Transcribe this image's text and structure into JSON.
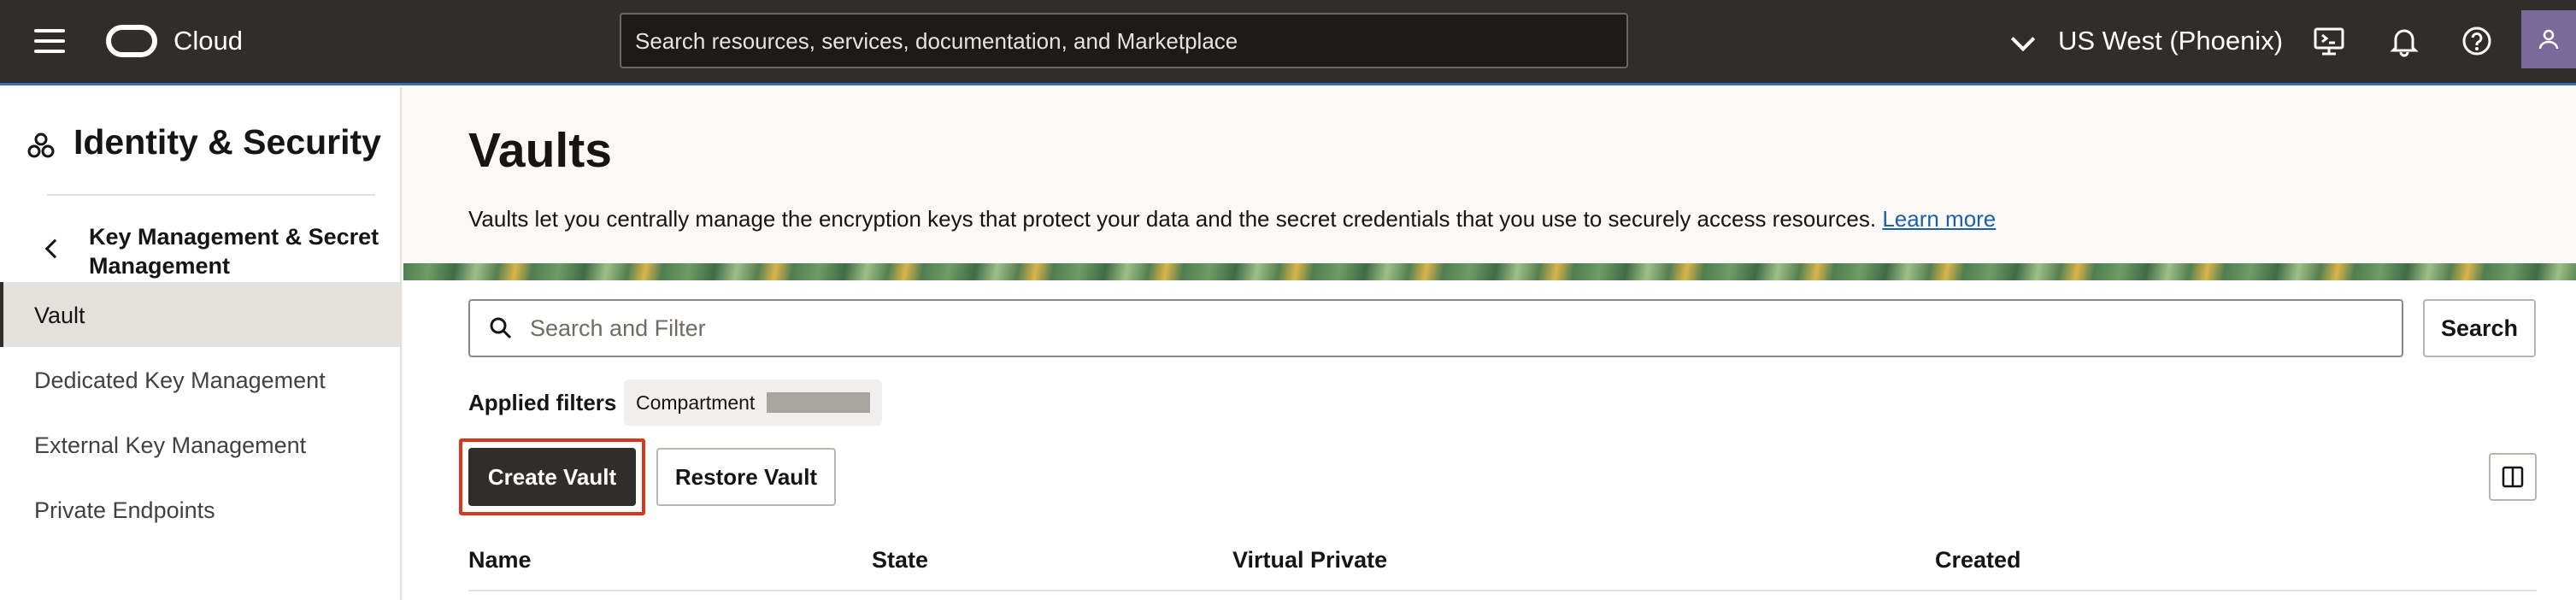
{
  "topbar": {
    "brand": "Cloud",
    "search_placeholder": "Search resources, services, documentation, and Marketplace",
    "region": "US West (Phoenix)"
  },
  "sidebar": {
    "title": "Identity & Security",
    "section": "Key Management & Secret Management",
    "items": [
      {
        "label": "Vault",
        "active": true
      },
      {
        "label": "Dedicated Key Management",
        "active": false
      },
      {
        "label": "External Key Management",
        "active": false
      },
      {
        "label": "Private Endpoints",
        "active": false
      }
    ]
  },
  "main": {
    "title": "Vaults",
    "description": "Vaults let you centrally manage the encryption keys that protect your data and the secret credentials that you use to securely access resources.",
    "learn_more": "Learn more",
    "filter_placeholder": "Search and Filter",
    "search_button": "Search",
    "applied_filters_label": "Applied filters",
    "filter_chip": "Compartment",
    "create_button": "Create Vault",
    "restore_button": "Restore Vault",
    "columns": [
      "Name",
      "State",
      "Virtual Private",
      "Created"
    ]
  },
  "colors": {
    "topbar": "#312d2a",
    "primary_button": "#312d2a",
    "highlight": "#d9361e",
    "link": "#1c5fa8"
  },
  "icons": {
    "menu": "hamburger-icon",
    "region": "chevron-down-icon",
    "cloud_shell": "cloud-shell-icon",
    "notifications": "bell-icon",
    "help": "help-icon",
    "profile": "user-icon",
    "section": "identity-icon",
    "back": "chevron-left-icon",
    "search": "search-icon",
    "columns": "columns-icon"
  }
}
